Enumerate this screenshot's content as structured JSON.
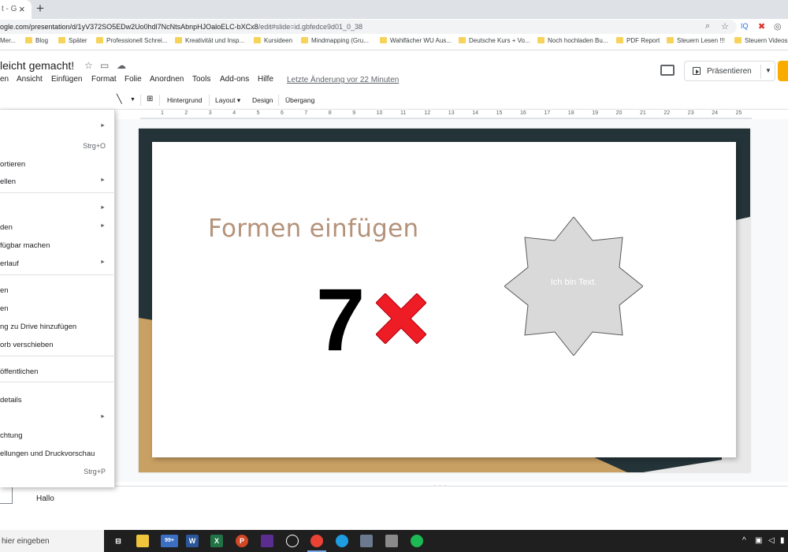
{
  "browser": {
    "tab_title": "t - G",
    "url_prefix": "ogle.com/presentation/d/1yV372SO5EDw2Uo0hdl7NcNtsAbnpHJOaloELC-bXCx8",
    "url_rest": "/edit#slide=id.gbfedce9d01_0_38",
    "bookmarks": [
      {
        "label": "Mer..."
      },
      {
        "label": "Blog"
      },
      {
        "label": "Später"
      },
      {
        "label": "Professionell Schrei..."
      },
      {
        "label": "Kreativität und Insp..."
      },
      {
        "label": "Kursideen"
      },
      {
        "label": "Mindmapping (Gru..."
      },
      {
        "label": "Wahlfächer WU Aus..."
      },
      {
        "label": "Deutsche Kurs + Vo..."
      },
      {
        "label": "Noch hochladen Bu..."
      },
      {
        "label": "PDF Report"
      },
      {
        "label": "Steuern Lesen !!!"
      },
      {
        "label": "Steuern Videos"
      }
    ]
  },
  "doc": {
    "title": "leicht gemacht!",
    "menu": [
      "en",
      "Ansicht",
      "Einfügen",
      "Format",
      "Folie",
      "Anordnen",
      "Tools",
      "Add-ons",
      "Hilfe"
    ],
    "last_edit": "Letzte Änderung vor 22 Minuten",
    "present_label": "Präsentieren"
  },
  "toolbar": {
    "hintergrund": "Hintergrund",
    "layout": "Layout",
    "design": "Design",
    "uebergang": "Übergang"
  },
  "ruler": [
    "1",
    "2",
    "3",
    "4",
    "5",
    "6",
    "7",
    "8",
    "9",
    "10",
    "11",
    "12",
    "13",
    "14",
    "15",
    "16",
    "17",
    "18",
    "19",
    "20",
    "21",
    "22",
    "23",
    "24",
    "25"
  ],
  "dropdown": [
    {
      "label": "",
      "arrow": true
    },
    {
      "label": "",
      "shortcut": "Strg+O"
    },
    {
      "label": "ortieren"
    },
    {
      "label": "ellen",
      "arrow": true
    },
    {
      "sep": true
    },
    {
      "label": "",
      "arrow": true
    },
    {
      "label": "den",
      "arrow": true
    },
    {
      "label": "fügbar machen"
    },
    {
      "label": "erlauf",
      "arrow": true
    },
    {
      "sep": true
    },
    {
      "label": "en"
    },
    {
      "label": "en"
    },
    {
      "label": "ng zu Drive hinzufügen"
    },
    {
      "label": "orb verschieben"
    },
    {
      "sep": true
    },
    {
      "label": "öffentlichen"
    },
    {
      "sep": true
    },
    {
      "label": "details"
    },
    {
      "label": "",
      "arrow": true
    },
    {
      "label": "chtung"
    },
    {
      "label": "ellungen und Druckvorschau"
    },
    {
      "label": "",
      "shortcut": "Strg+P"
    }
  ],
  "slide": {
    "title": "Formen einfügen",
    "number": "7",
    "shape_text": "Ich bin Text.",
    "colors": {
      "dark": "#243338",
      "gold": "#c9a063",
      "title": "#b4927a",
      "shape_fill": "#d9d9d9",
      "x_red": "#ee1c24"
    }
  },
  "notes": {
    "text": "Hallo"
  },
  "taskbar": {
    "search": "hier eingeben",
    "badge": "99+",
    "apps": [
      "taskview-icon",
      "explorer-icon",
      "mail-icon",
      "word-icon",
      "excel-icon",
      "powerpoint-icon",
      "app-icon",
      "clock-icon",
      "chrome-icon",
      "edge-icon",
      "calculator-icon",
      "notes-icon",
      "spotify-icon"
    ]
  }
}
